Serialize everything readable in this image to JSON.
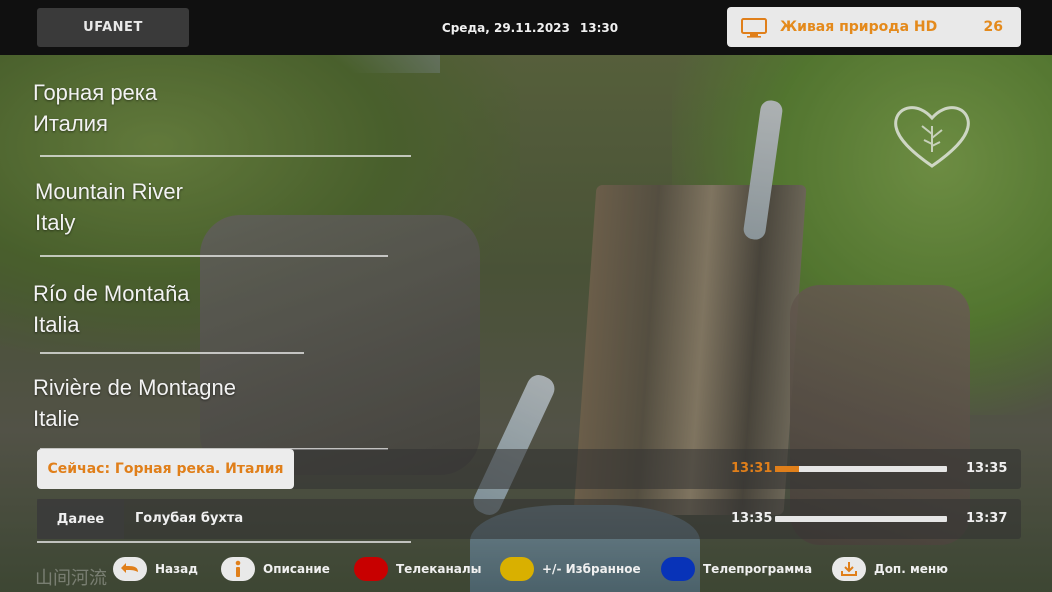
{
  "top_bar": {
    "brand": "UFANET",
    "date": "Среда, 29.11.2023",
    "time": "13:30",
    "channel_name": "Живая природа HD",
    "channel_number": "26"
  },
  "titles": [
    {
      "line1": "Горная река",
      "line2": "Италия"
    },
    {
      "line1": "Mountain River",
      "line2": "Italy"
    },
    {
      "line1": "Río de Montaña",
      "line2": "Italia"
    },
    {
      "line1": "Rivière de Montagne",
      "line2": "Italie"
    }
  ],
  "watermark_text": "山间河流",
  "now": {
    "label": "Сейчас: Горная река. Италия",
    "start": "13:31",
    "end": "13:35",
    "progress": 0.14
  },
  "next": {
    "label": "Далее",
    "title": "Голубая бухта",
    "start": "13:35",
    "end": "13:37"
  },
  "legend": [
    {
      "icon": "back-arrow-icon",
      "color": "white",
      "label": "Назад"
    },
    {
      "icon": "info-icon",
      "color": "white",
      "label": "Описание"
    },
    {
      "icon": "red-key-icon",
      "color": "red",
      "label": "Телеканалы"
    },
    {
      "icon": "yellow-key-icon",
      "color": "yellow",
      "label": "+/- Избранное"
    },
    {
      "icon": "blue-key-icon",
      "color": "blue",
      "label": "Телепрограмма"
    },
    {
      "icon": "download-menu-icon",
      "color": "white",
      "label": "Доп. меню"
    }
  ],
  "colors": {
    "accent": "#e07f1a",
    "red_key": "#c80000",
    "yellow_key": "#d9b000",
    "blue_key": "#0833b8"
  }
}
